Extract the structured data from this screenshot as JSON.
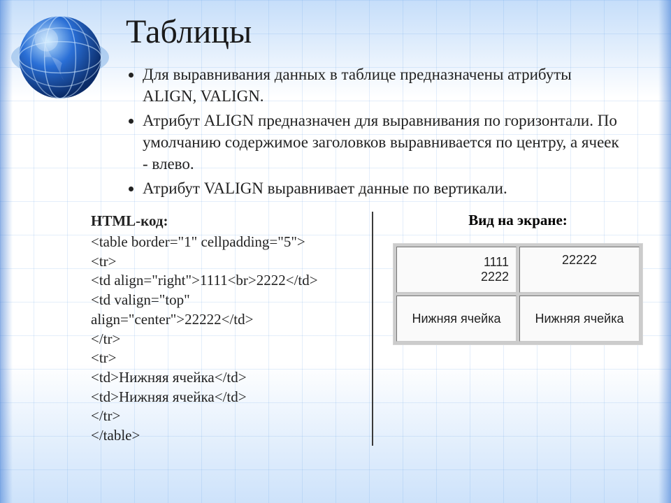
{
  "title": "Таблицы",
  "bullets": [
    "Для выравнивания данных в таблице предназначены атрибуты ALIGN, VALIGN.",
    "Атрибут ALIGN предназначен для выравнивания по горизонтали. По умолчанию содержимое заголовков выравнивается по центру, а ячеек - влево.",
    "Атрибут VALIGN выравнивает данные по вертикали."
  ],
  "code": {
    "label": "HTML-код:",
    "lines": [
      "<table border=\"1\" cellpadding=\"5\">",
      " <tr>",
      "  <td align=\"right\">1111<br>2222</td>",
      "  <td valign=\"top\"",
      "align=\"center\">22222</td>",
      " </tr>",
      " <tr>",
      "  <td>Нижняя ячейка</td>",
      "  <td>Нижняя ячейка</td>",
      " </tr>",
      " </table>"
    ]
  },
  "view": {
    "label": "Вид на экране:",
    "row1": {
      "cell1_line1": "1111",
      "cell1_line2": "2222",
      "cell2": "22222"
    },
    "row2": {
      "cell1": "Нижняя ячейка",
      "cell2": "Нижняя ячейка"
    }
  }
}
